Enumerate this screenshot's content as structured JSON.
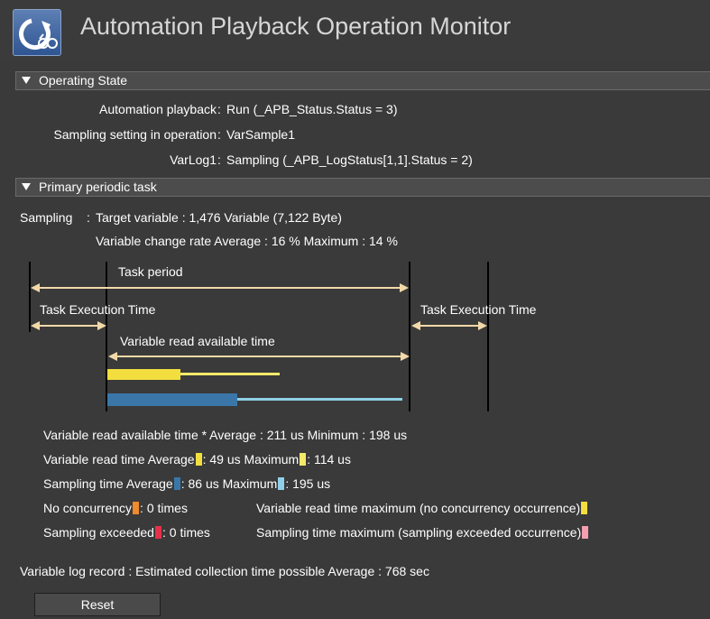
{
  "app": {
    "title": "Automation Playback Operation Monitor"
  },
  "operating_state": {
    "header": "Operating State",
    "rows": [
      {
        "label": "Automation playback",
        "value": "Run (_APB_Status.Status = 3)"
      },
      {
        "label": "Sampling setting in operation",
        "value": "VarSample1"
      },
      {
        "label": "VarLog1",
        "value": "Sampling (_APB_LogStatus[1,1].Status = 2)"
      }
    ]
  },
  "primary_task": {
    "header": "Primary periodic task",
    "sampling_label": "Sampling",
    "target_variable": "Target variable : 1,476 Variable (7,122 Byte)",
    "change_rate": "Variable change rate   Average : 16 %   Maximum : 14 %",
    "diagram": {
      "task_period": "Task period",
      "task_exec_left": "Task Execution Time",
      "task_exec_right": "Task Execution Time",
      "var_read_avail": "Variable read available time"
    },
    "stats": {
      "read_avail": "Variable read available time *   Average : 211 us   Minimum : 198 us",
      "read_time_a": "Variable read time   Average",
      "read_time_b": ": 49 us   Maximum",
      "read_time_c": ": 114 us",
      "sampling_a": "Sampling time   Average",
      "sampling_b": ": 86 us   Maximum",
      "sampling_c": ": 195 us",
      "no_conc_a": "No concurrency",
      "no_conc_b": ": 0 times",
      "no_conc_max": "Variable read time maximum (no concurrency occurrence)",
      "samp_exc_a": "Sampling exceeded",
      "samp_exc_b": ": 0 times",
      "samp_exc_max": "Sampling time maximum (sampling exceeded occurrence)"
    }
  },
  "log_record": "Variable log record : Estimated collection time possible   Average : 768 sec",
  "reset_label": "Reset",
  "colors": {
    "yellow": "#f2de3e",
    "light_yellow": "#f5e96a",
    "blue": "#3a77a8",
    "light_blue": "#8fd0e8",
    "orange": "#f08a2c",
    "red": "#e4324a",
    "pink": "#f4a0b0",
    "arrow": "#f3d9a8"
  }
}
